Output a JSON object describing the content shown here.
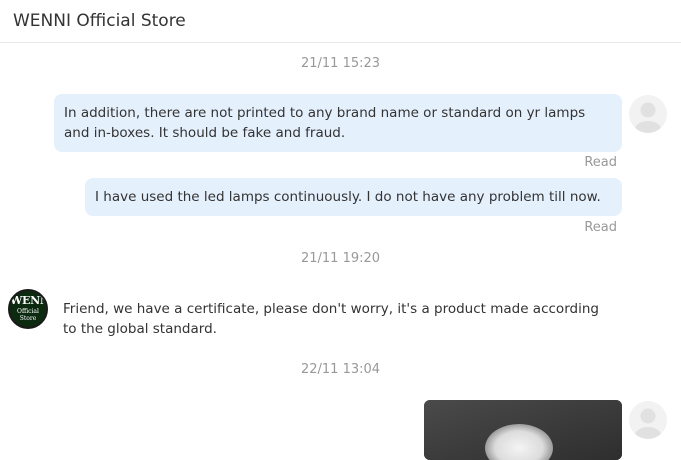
{
  "header": {
    "title": "WENNI Official Store"
  },
  "messages": [
    {
      "time": "21/11 15:23"
    },
    {
      "text_line1": "In addition, there are not printed to any brand name or standard on yr lamps",
      "text_line2": "and in-boxes. It should be fake and fraud.",
      "status": "Read"
    },
    {
      "text": "I have used the led lamps continuously. I do not have any problem till now.",
      "status": "Read"
    },
    {
      "time": "21/11 19:20"
    },
    {
      "text_line1": "Friend, we have a certificate, please don't worry, it's a product made according",
      "text_line2": "to the global standard."
    },
    {
      "time": "22/11 13:04"
    }
  ],
  "store_avatar": {
    "logo_text": "WENNI",
    "logo_line1": "Official",
    "logo_line2": "Store"
  },
  "colors": {
    "outgoing_bubble": "#e5f0fd",
    "timestamp": "#999999",
    "store_avatar_bg": "#0c2a10"
  }
}
